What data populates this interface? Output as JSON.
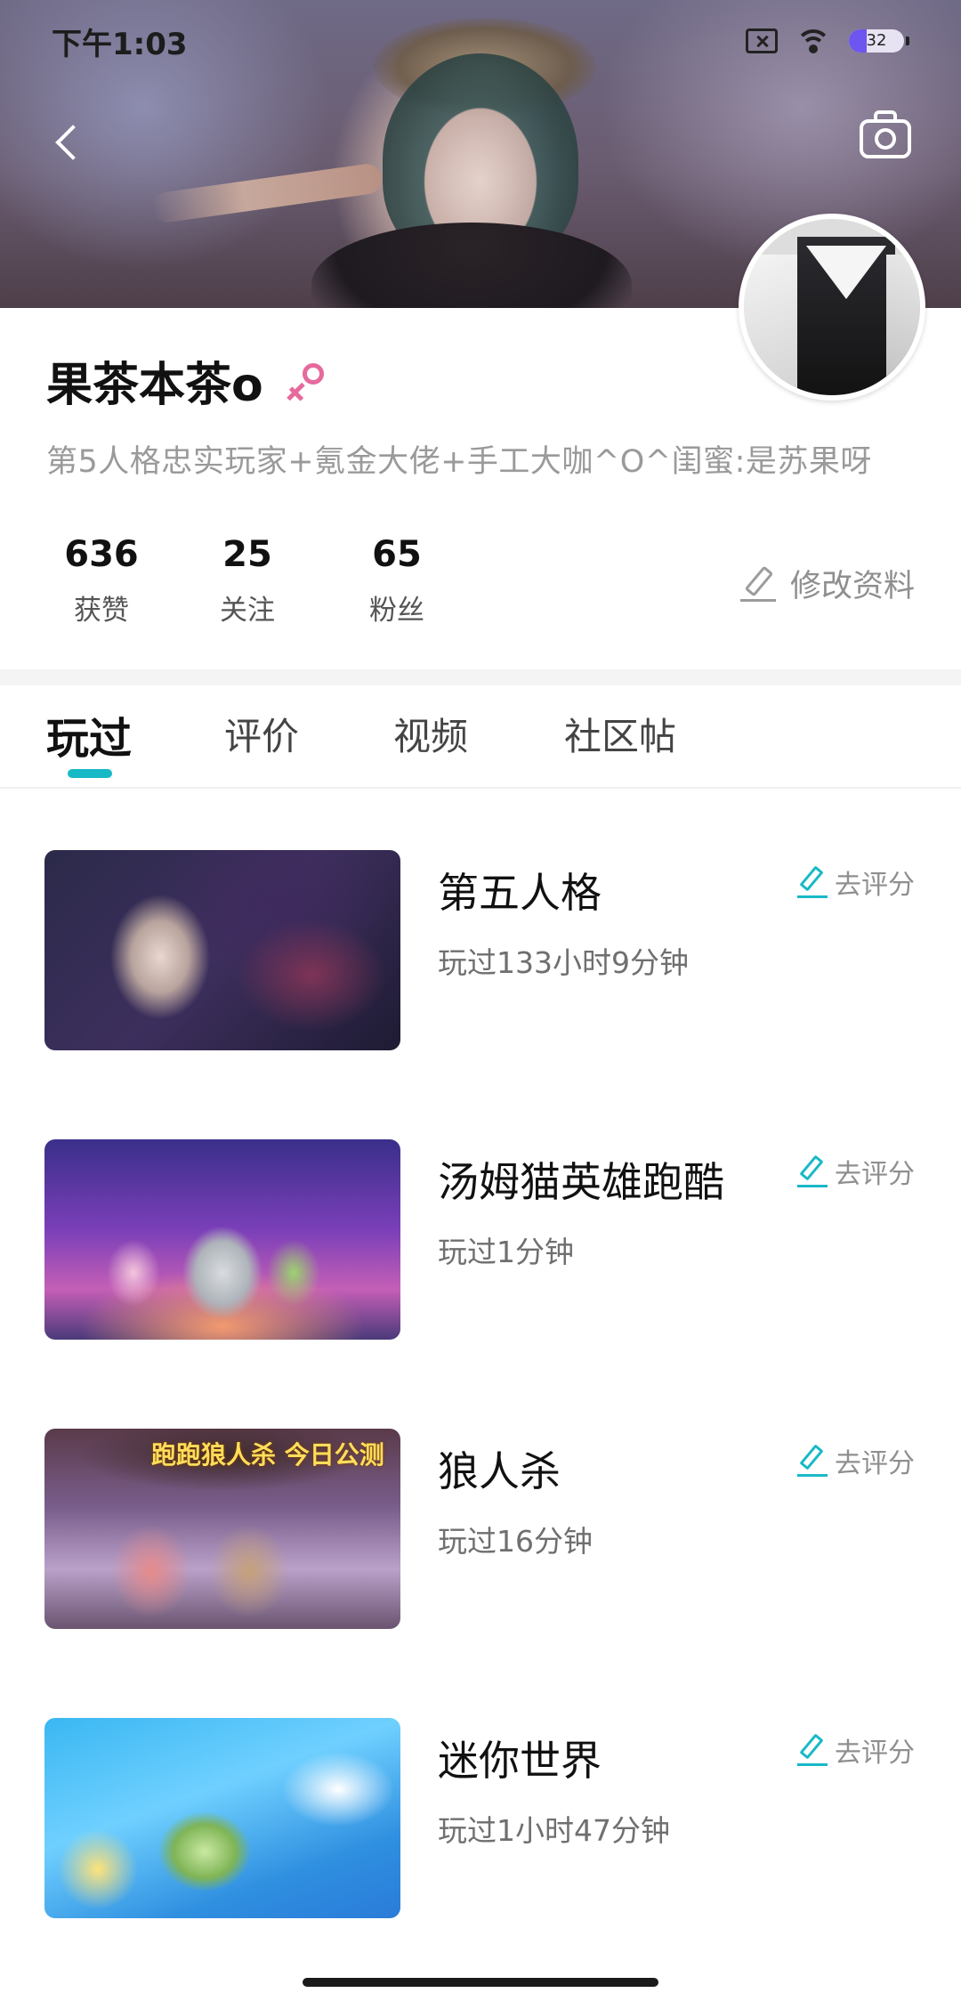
{
  "status_bar": {
    "time": "下午1:03",
    "battery_level": 32,
    "battery_text": "32",
    "battery_color": "#6d55f0"
  },
  "header": {
    "back_icon": "chevron-left-icon",
    "camera_icon": "camera-icon"
  },
  "profile": {
    "nickname": "果茶本茶o",
    "gender_icon": "female-icon",
    "gender_color": "#e66a9c",
    "bio": "第5人格忠实玩家+氪金大佬+手工大咖^O^闺蜜:是苏果呀",
    "stats": [
      {
        "value": "636",
        "label": "获赞"
      },
      {
        "value": "25",
        "label": "关注"
      },
      {
        "value": "65",
        "label": "粉丝"
      }
    ],
    "edit_label": "修改资料"
  },
  "tabs": [
    {
      "label": "玩过",
      "active": true
    },
    {
      "label": "评价",
      "active": false
    },
    {
      "label": "视频",
      "active": false
    },
    {
      "label": "社区帖",
      "active": false
    }
  ],
  "accent_color": "#18b9c7",
  "games": [
    {
      "name": "第五人格",
      "time": "玩过133小时9分钟",
      "rate_label": "去评分"
    },
    {
      "name": "汤姆猫英雄跑酷",
      "time": "玩过1分钟",
      "rate_label": "去评分"
    },
    {
      "name": "狼人杀",
      "time": "玩过16分钟",
      "rate_label": "去评分",
      "thumb_text": "跑跑狼人杀 今日公测"
    },
    {
      "name": "迷你世界",
      "time": "玩过1小时47分钟",
      "rate_label": "去评分"
    }
  ]
}
